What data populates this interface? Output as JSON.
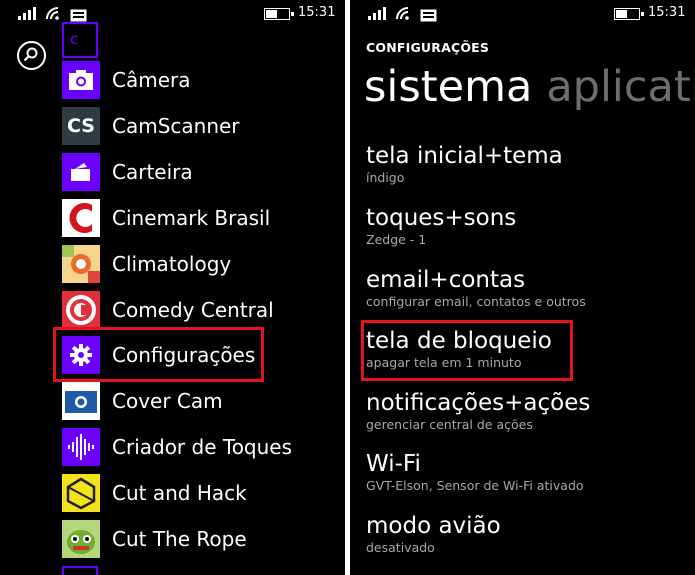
{
  "status_bar": {
    "time": "15:31",
    "battery_level": 0.55
  },
  "left_screen": {
    "group_letter": "c",
    "apps": [
      {
        "name": "Câmera",
        "icon": "camera-icon",
        "color": "#6a00ff"
      },
      {
        "name": "CamScanner",
        "icon": "camscanner-cs-icon",
        "color": "#2f3b43"
      },
      {
        "name": "Carteira",
        "icon": "wallet-icon",
        "color": "#6a00ff"
      },
      {
        "name": "Cinemark Brasil",
        "icon": "cinemark-icon",
        "color": "#d3141c"
      },
      {
        "name": "Climatology",
        "icon": "climatology-icon",
        "color": "#f0a030"
      },
      {
        "name": "Comedy Central",
        "icon": "comedy-central-icon",
        "color": "#e0303c"
      },
      {
        "name": "Configurações",
        "icon": "gear-icon",
        "color": "#6a00ff"
      },
      {
        "name": "Cover Cam",
        "icon": "cover-cam-icon",
        "color": "#1e5aa8"
      },
      {
        "name": "Criador de Toques",
        "icon": "audio-wave-icon",
        "color": "#6a00ff"
      },
      {
        "name": "Cut and Hack",
        "icon": "cut-and-hack-icon",
        "color": "#f4e21c"
      },
      {
        "name": "Cut The Rope",
        "icon": "cut-the-rope-icon",
        "color": "#8bc34a"
      }
    ]
  },
  "right_screen": {
    "header": "CONFIGURAÇÕES",
    "pivot_active": "sistema",
    "pivot_next": "aplicati",
    "settings": [
      {
        "title": "tela inicial+tema",
        "subtitle": "índigo"
      },
      {
        "title": "toques+sons",
        "subtitle": "Zedge - 1"
      },
      {
        "title": "email+contas",
        "subtitle": "configurar email, contatos e outros"
      },
      {
        "title": "tela de bloqueio",
        "subtitle": "apagar tela em 1 minuto"
      },
      {
        "title": "notificações+ações",
        "subtitle": "gerenciar central de ações"
      },
      {
        "title": "Wi-Fi",
        "subtitle": "GVT-Elson, Sensor de Wi-Fi ativado"
      },
      {
        "title": "modo avião",
        "subtitle": "desativado"
      }
    ]
  },
  "colors": {
    "accent": "#6a00ff",
    "highlight": "#e3141e",
    "subtext": "#a8a8a8"
  }
}
